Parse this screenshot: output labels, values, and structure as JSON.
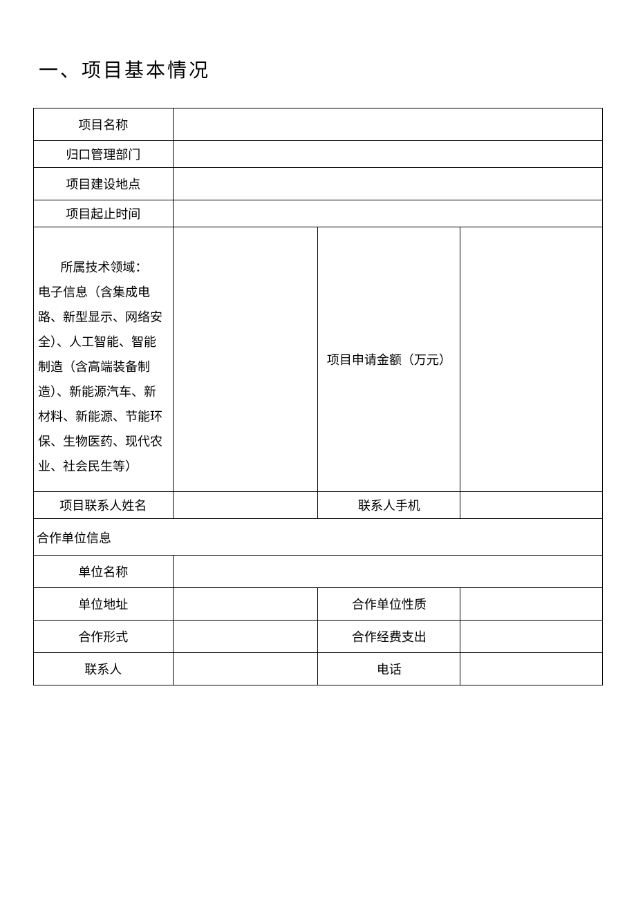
{
  "heading": "一、项目基本情况",
  "rows": {
    "project_name_label": "项目名称",
    "project_name_value": "",
    "management_dept_label": "归口管理部门",
    "management_dept_value": "",
    "build_location_label": "项目建设地点",
    "build_location_value": "",
    "start_end_label": "项目起止时间",
    "start_end_value": "",
    "tech_field_first_line": "所属技术领域：",
    "tech_field_rest": "电子信息（含集成电路、新型显示、网络安全）、人工智能、智能制造（含高端装备制造）、新能源汽车、新材料、新能源、节能环保、生物医药、现代农业、社会民生等）",
    "tech_field_value": "",
    "apply_amount_label": "项目申请金额（万元）",
    "apply_amount_value": "",
    "contact_name_label": "项目联系人姓名",
    "contact_name_value": "",
    "contact_phone_label": "联系人手机",
    "contact_phone_value": "",
    "partner_section": "合作单位信息",
    "partner_unit_name_label": "单位名称",
    "partner_unit_name_value": "",
    "partner_unit_addr_label": "单位地址",
    "partner_unit_addr_value": "",
    "partner_unit_nature_label": "合作单位性质",
    "partner_unit_nature_value": "",
    "coop_form_label": "合作形式",
    "coop_form_value": "",
    "coop_expense_label": "合作经费支出",
    "coop_expense_value": "",
    "partner_contact_label": "联系人",
    "partner_contact_value": "",
    "partner_phone_label": "电话",
    "partner_phone_value": ""
  }
}
